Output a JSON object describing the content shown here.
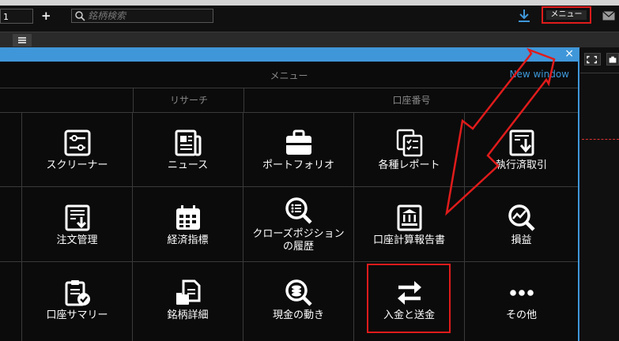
{
  "topbar": {
    "tab_number": "1",
    "add_label": "+",
    "search_placeholder": "銘柄検索",
    "menu_button_label": "メニュー"
  },
  "menu_window": {
    "title": "メニュー",
    "new_window_link": "New window",
    "close_label": "×",
    "categories": [
      "リサーチ",
      "口座番号"
    ],
    "items": [
      {
        "label": "スクリーナー",
        "icon": "screener-icon"
      },
      {
        "label": "ニュース",
        "icon": "news-icon"
      },
      {
        "label": "ポートフォリオ",
        "icon": "portfolio-icon"
      },
      {
        "label": "各種レポート",
        "icon": "reports-icon"
      },
      {
        "label": "執行済取引",
        "icon": "executed-trades-icon"
      },
      {
        "label": "注文管理",
        "icon": "order-management-icon"
      },
      {
        "label": "経済指標",
        "icon": "calendar-icon"
      },
      {
        "label": "クローズポジション",
        "label2": "の履歴",
        "icon": "closed-positions-icon"
      },
      {
        "label": "口座計算報告書",
        "icon": "account-statement-icon"
      },
      {
        "label": "損益",
        "icon": "profit-loss-icon"
      },
      {
        "label": "口座サマリー",
        "icon": "account-summary-icon"
      },
      {
        "label": "銘柄詳細",
        "icon": "instrument-details-icon"
      },
      {
        "label": "現金の動き",
        "icon": "cash-movements-icon"
      },
      {
        "label": "入金と送金",
        "icon": "transfer-icon"
      },
      {
        "label": "その他",
        "icon": "more-icon"
      }
    ]
  },
  "colors": {
    "accent": "#3f97d9",
    "highlight": "#e01b1b",
    "background": "#0b0b0b"
  }
}
